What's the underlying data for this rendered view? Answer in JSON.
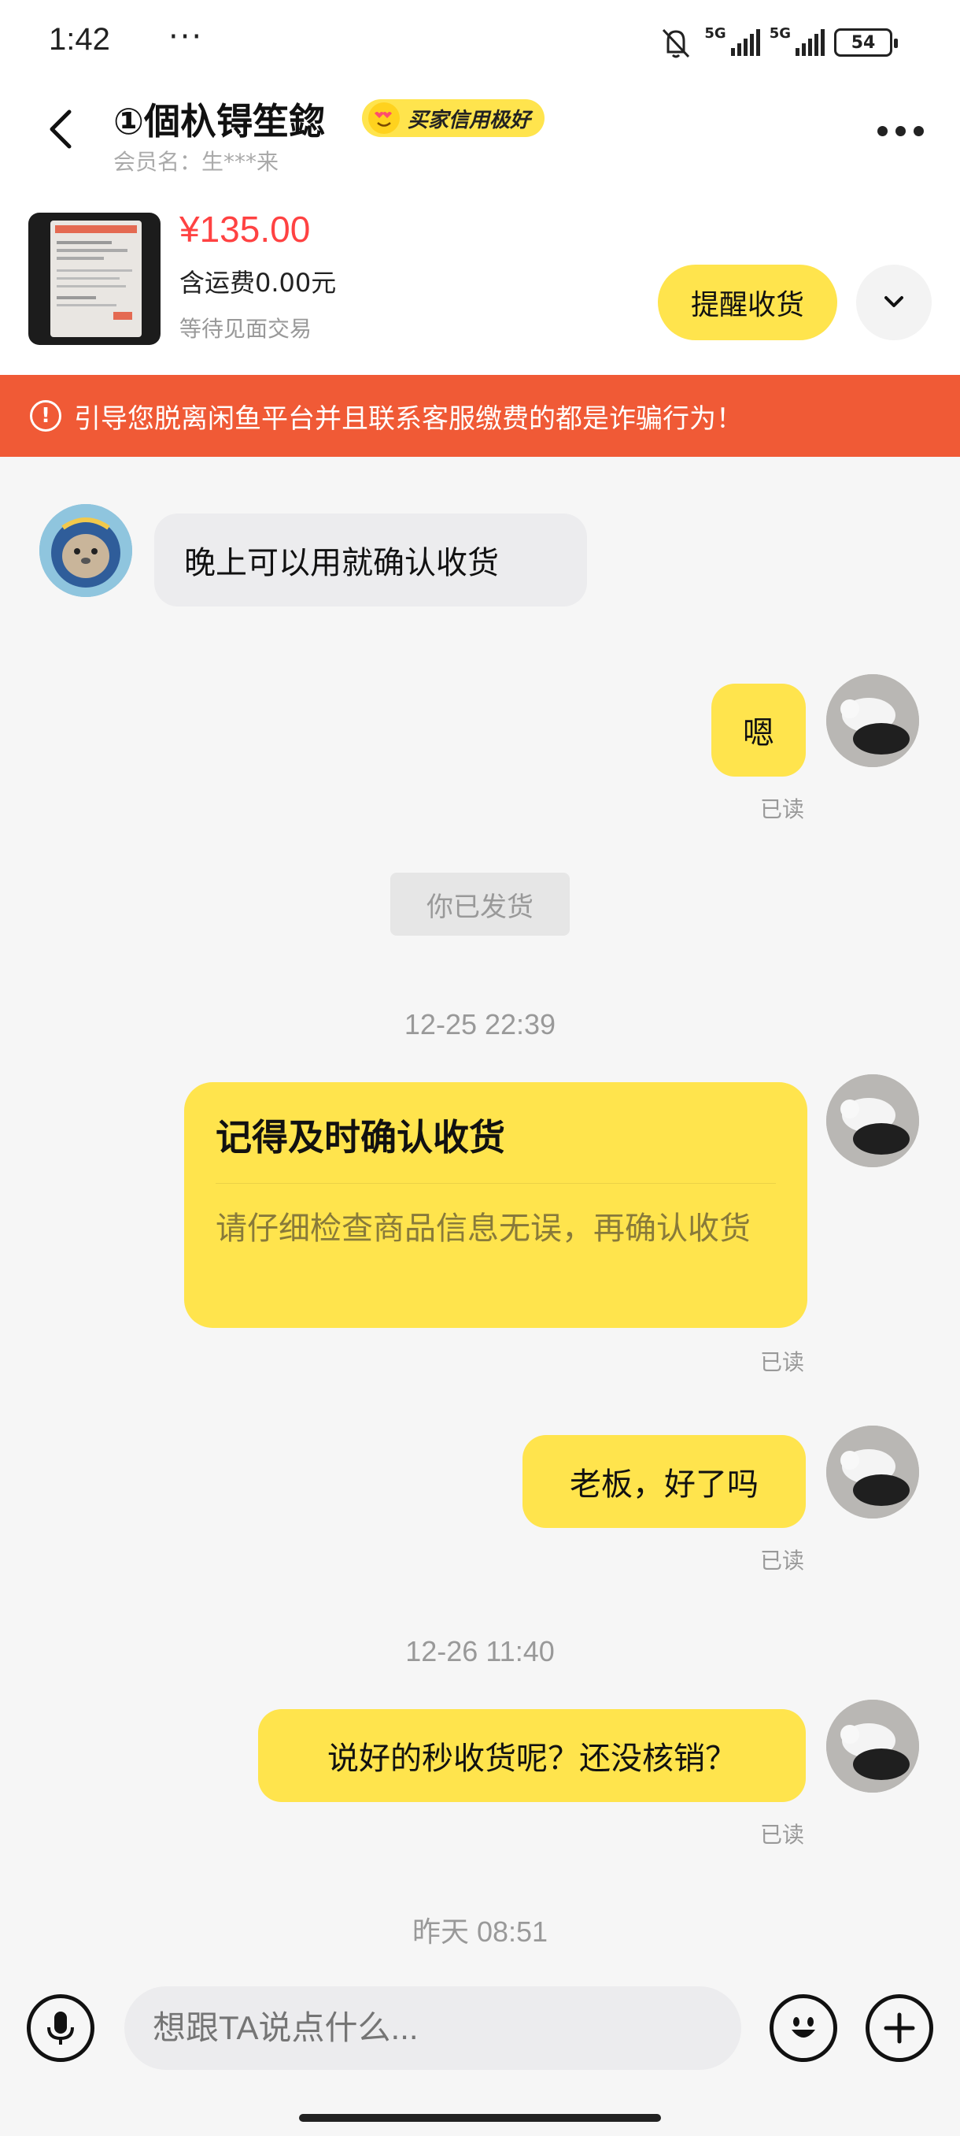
{
  "status_bar": {
    "time": "1:42",
    "extra": "⁂",
    "dots": "···",
    "net1": "5G",
    "net2": "5G",
    "battery": "54"
  },
  "header": {
    "title": "①個杁锝笙鍃",
    "badge": "买家信用极好",
    "member": "会员名：生***来"
  },
  "product": {
    "price": "¥135.00",
    "shipping": "含运费0.00元",
    "trade_status": "等待见面交易",
    "remind_button": "提醒收货"
  },
  "warning": {
    "icon": "!",
    "text": "引导您脱离闲鱼平台并且联系客服缴费的都是诈骗行为！"
  },
  "messages": {
    "m1": "晚上可以用就确认收货",
    "m2": "嗯",
    "m2_read": "已读",
    "sys": "你已发货",
    "time1": "12-25 22:39",
    "card_title": "记得及时确认收货",
    "card_body": "请仔细检查商品信息无误，再确认收货",
    "card_read": "已读",
    "m3": "老板，好了吗",
    "m3_read": "已读",
    "time2": "12-26 11:40",
    "m4": "说好的秒收货呢？还没核销？",
    "m4_read": "已读",
    "time3": "昨天 08:51"
  },
  "input": {
    "placeholder": "想跟TA说点什么..."
  },
  "colors": {
    "accent_yellow": "#ffe44d",
    "warning_orange": "#f05a36",
    "price_red": "#ff4242"
  }
}
